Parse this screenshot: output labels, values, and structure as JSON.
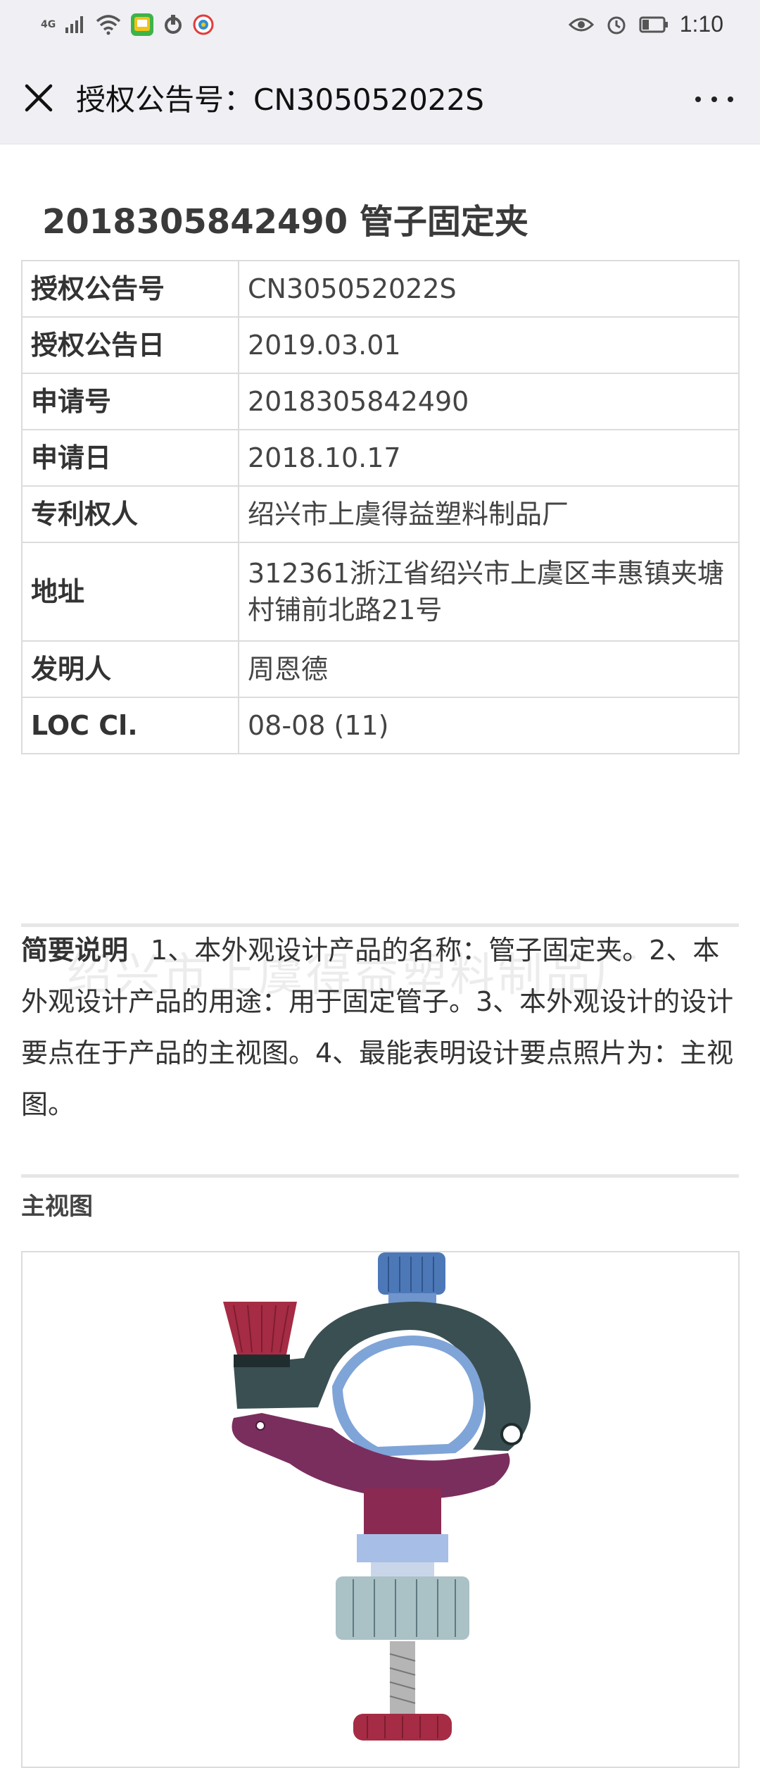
{
  "status_bar": {
    "network": "4G",
    "time": "1:10",
    "icons": [
      "signal-icon",
      "wifi-icon",
      "app-icon",
      "taobao-icon",
      "weibo-icon",
      "eye-icon",
      "alarm-icon",
      "battery-icon"
    ]
  },
  "app_bar": {
    "title": "授权公告号：CN305052022S",
    "close_icon": "close-icon",
    "more_icon": "more-icon"
  },
  "document": {
    "title": "2018305842490  管子固定夹",
    "rows": [
      {
        "key": "授权公告号",
        "value": "CN305052022S"
      },
      {
        "key": "授权公告日",
        "value": "2019.03.01"
      },
      {
        "key": "申请号",
        "value": "2018305842490"
      },
      {
        "key": "申请日",
        "value": "2018.10.17"
      },
      {
        "key": "专利权人",
        "value": "绍兴市上虞得益塑料制品厂"
      },
      {
        "key": "地址",
        "value": "312361浙江省绍兴市上虞区丰惠镇夹塘村铺前北路21号"
      },
      {
        "key": "发明人",
        "value": "周恩德"
      },
      {
        "key": "LOC Cl.",
        "value": "08-08 (11)"
      }
    ],
    "summary_label": "简要说明",
    "summary_text": "1、本外观设计产品的名称：管子固定夹。2、本外观设计产品的用途：用于固定管子。3、本外观设计的设计要点在于产品的主视图。4、最能表明设计要点照片为：主视图。",
    "watermark": "绍兴市上虞得益塑料制品厂",
    "figure_label": "主视图"
  },
  "colors": {
    "appbar_bg": "#efeff4",
    "border": "#dcdcdc",
    "clamp_dark": "#3a4f52",
    "clamp_purple": "#7a2e5e",
    "knob_red": "#a52c44",
    "knob_blue": "#4d78b8"
  }
}
